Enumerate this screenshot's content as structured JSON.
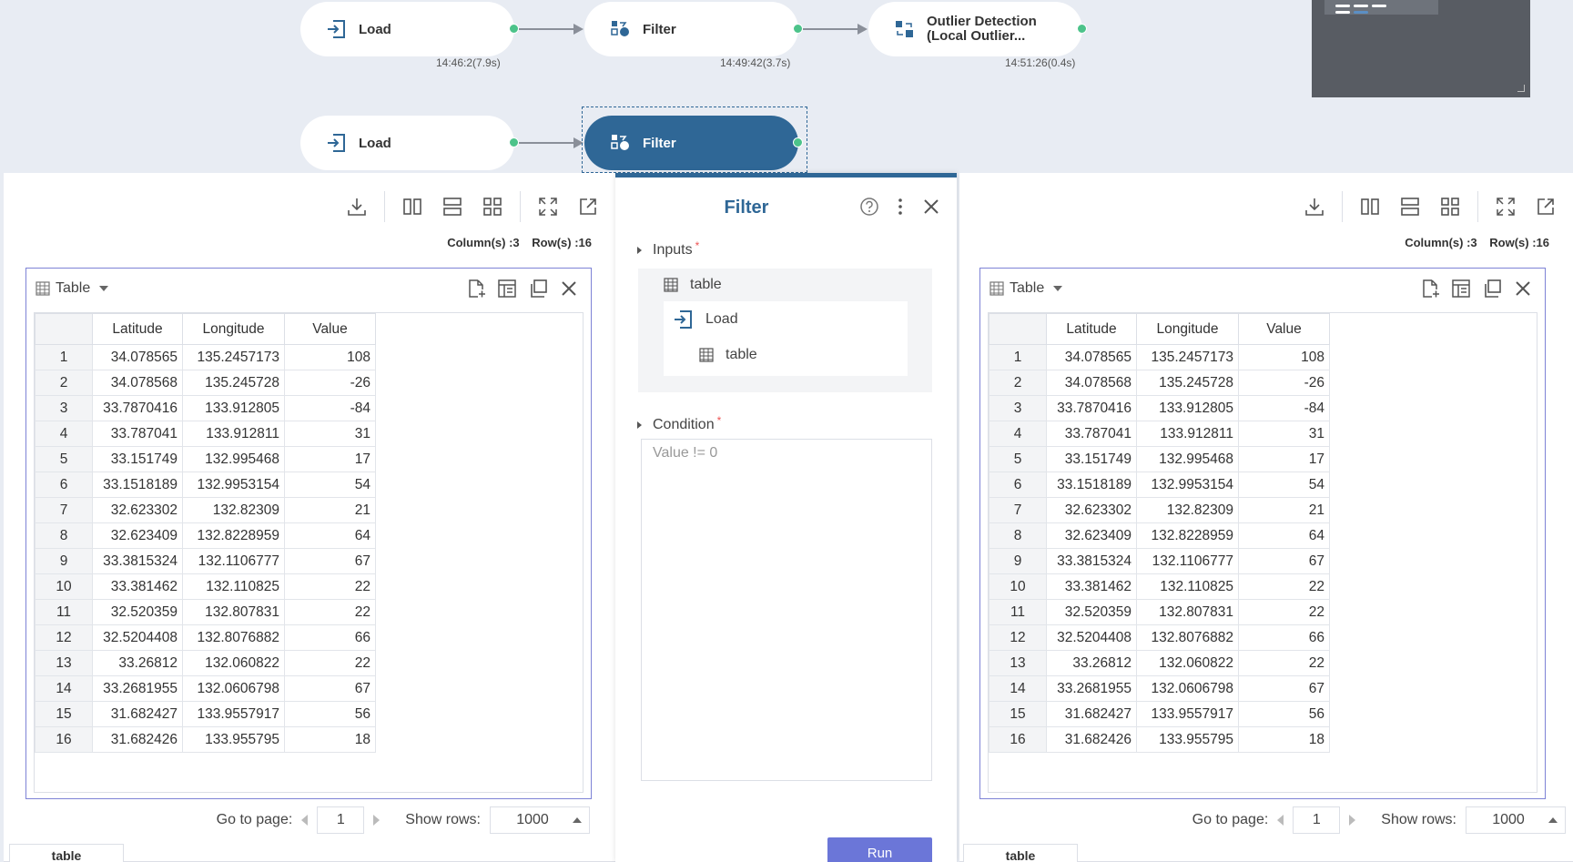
{
  "pipeline": {
    "row1": [
      {
        "label": "Load",
        "time": "14:46:2(7.9s)"
      },
      {
        "label": "Filter",
        "time": "14:49:42(3.7s)"
      },
      {
        "label_line1": "Outlier Detection",
        "label_line2": "(Local Outlier...",
        "time": "14:51:26(0.4s)"
      }
    ],
    "row2": [
      {
        "label": "Load"
      },
      {
        "label": "Filter"
      }
    ]
  },
  "colors": {
    "accent": "#2f6796",
    "run_button": "#6b76d8",
    "port": "#4cc38a",
    "widget_border": "#7e83d6"
  },
  "left_panel": {
    "columns_label": "Column(s) :3",
    "rows_label": "Row(s) :16",
    "widget_title": "Table",
    "pager": {
      "go_to_label": "Go to page:",
      "page": "1",
      "show_rows_label": "Show rows:",
      "show_rows_value": "1000"
    },
    "bottom_tab": "table"
  },
  "right_panel": {
    "columns_label": "Column(s) :3",
    "rows_label": "Row(s) :16",
    "widget_title": "Table",
    "pager": {
      "go_to_label": "Go to page:",
      "page": "1",
      "show_rows_label": "Show rows:",
      "show_rows_value": "1000"
    },
    "bottom_tab": "table"
  },
  "table": {
    "headers": [
      "Latitude",
      "Longitude",
      "Value"
    ],
    "rows": [
      [
        "1",
        "34.078565",
        "135.2457173",
        "108"
      ],
      [
        "2",
        "34.078568",
        "135.245728",
        "-26"
      ],
      [
        "3",
        "33.7870416",
        "133.912805",
        "-84"
      ],
      [
        "4",
        "33.787041",
        "133.912811",
        "31"
      ],
      [
        "5",
        "33.151749",
        "132.995468",
        "17"
      ],
      [
        "6",
        "33.1518189",
        "132.9953154",
        "54"
      ],
      [
        "7",
        "32.623302",
        "132.82309",
        "21"
      ],
      [
        "8",
        "32.623409",
        "132.8228959",
        "64"
      ],
      [
        "9",
        "33.3815324",
        "132.1106777",
        "67"
      ],
      [
        "10",
        "33.381462",
        "132.110825",
        "22"
      ],
      [
        "11",
        "32.520359",
        "132.807831",
        "22"
      ],
      [
        "12",
        "32.5204408",
        "132.8076882",
        "66"
      ],
      [
        "13",
        "33.26812",
        "132.060822",
        "22"
      ],
      [
        "14",
        "33.2681955",
        "132.0606798",
        "67"
      ],
      [
        "15",
        "31.682427",
        "133.9557917",
        "56"
      ],
      [
        "16",
        "31.682426",
        "133.955795",
        "18"
      ]
    ]
  },
  "dialog": {
    "title": "Filter",
    "inputs_label": "Inputs",
    "required_mark": "*",
    "input_table": "table",
    "input_source": "Load",
    "input_source_table": "table",
    "condition_label": "Condition",
    "condition_placeholder": "Value != 0",
    "run_label": "Run"
  }
}
